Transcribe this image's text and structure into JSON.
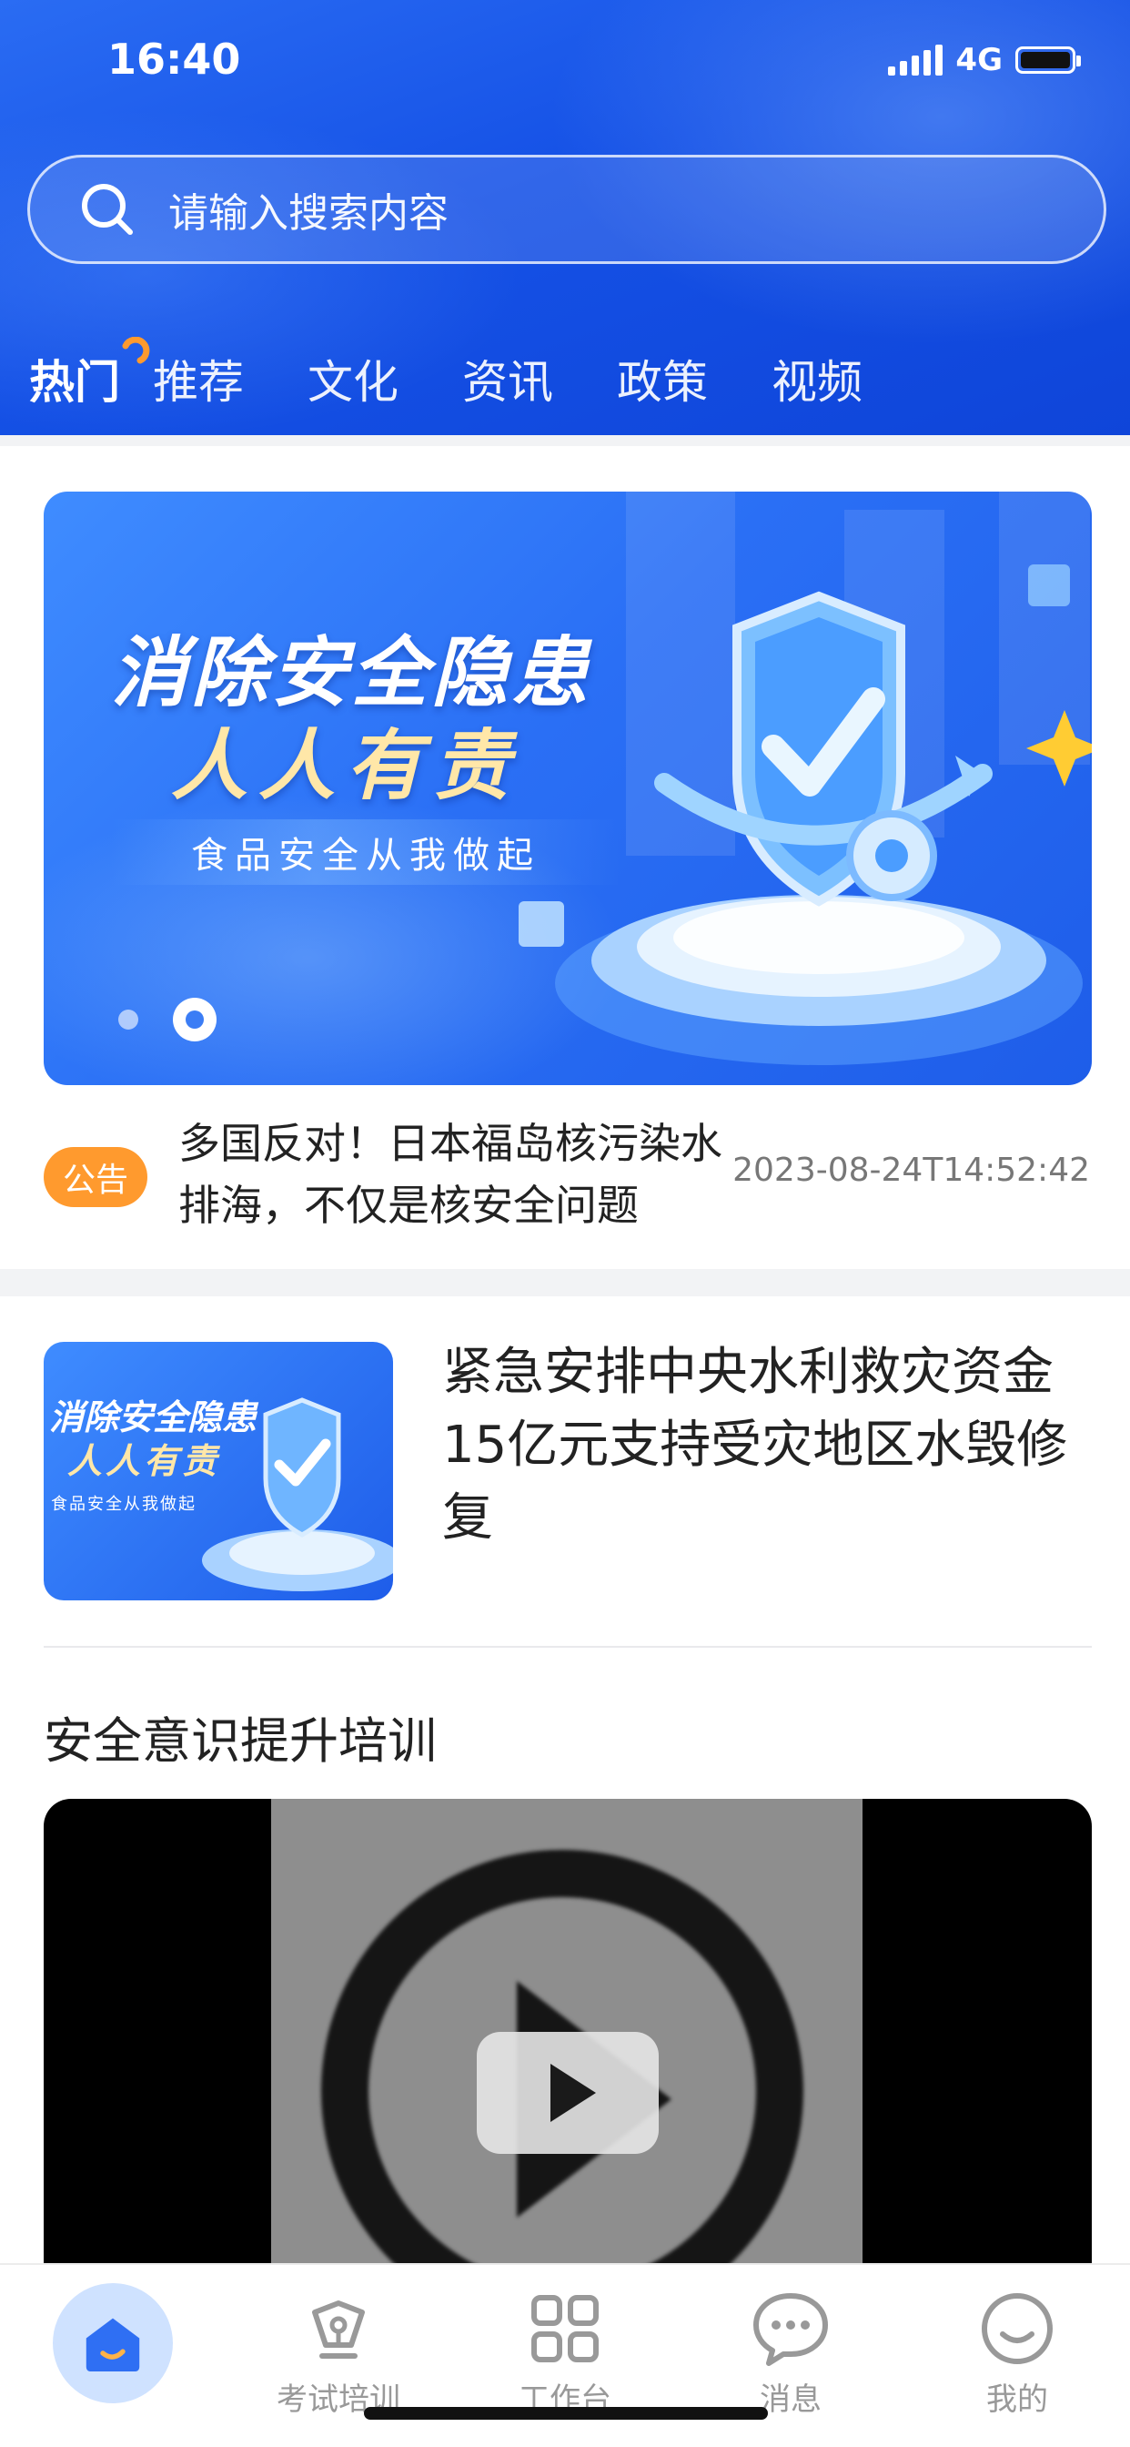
{
  "status": {
    "time": "16:40",
    "network": "4G"
  },
  "search": {
    "placeholder": "请输入搜索内容"
  },
  "tabs": [
    {
      "label": "热门",
      "active": true
    },
    {
      "label": "推荐"
    },
    {
      "label": "文化"
    },
    {
      "label": "资讯"
    },
    {
      "label": "政策"
    },
    {
      "label": "视频"
    }
  ],
  "banner": {
    "title_line1": "消除安全隐患",
    "title_line2": "人人有责",
    "subtitle": "食品安全从我做起",
    "page_count": 2,
    "active_page": 2
  },
  "announcement": {
    "badge": "公告",
    "title": "多国反对！日本福岛核污染水排海，不仅是核安全问题",
    "time": "2023-08-24T14:52:42"
  },
  "news": [
    {
      "title": "紧急安排中央水利救灾资金15亿元支持受灾地区水毁修复",
      "thumb_line1": "消除安全隐患",
      "thumb_line2": "人人有责",
      "thumb_line3": "食品安全从我做起"
    }
  ],
  "section": {
    "title": "安全意识提升培训"
  },
  "tabbar": [
    {
      "label": "",
      "icon": "home-icon",
      "active": true
    },
    {
      "label": "考试培训",
      "icon": "exam-icon"
    },
    {
      "label": "工作台",
      "icon": "workbench-icon"
    },
    {
      "label": "消息",
      "icon": "message-icon"
    },
    {
      "label": "我的",
      "icon": "profile-icon"
    }
  ],
  "colors": {
    "header_blue": "#1551e6",
    "badge_orange": "#ff9a2e",
    "tab_inactive": "#999999"
  }
}
